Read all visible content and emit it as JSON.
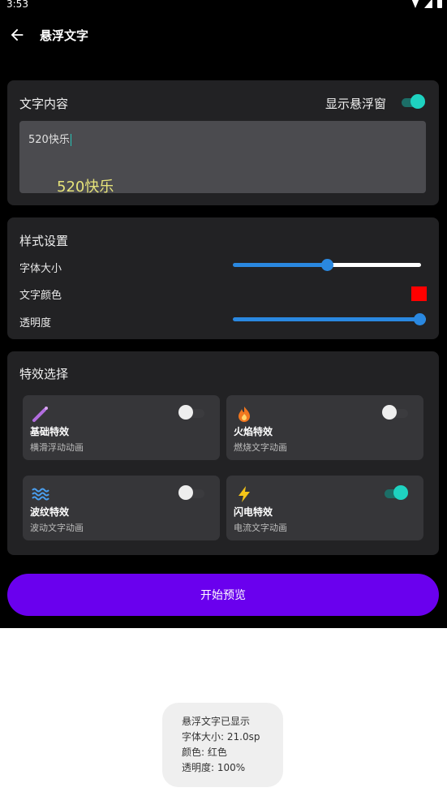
{
  "status_bar": {
    "time": "3:53"
  },
  "topbar": {
    "title": "悬浮文字",
    "back_icon": "arrow-left-icon"
  },
  "content_card": {
    "heading": "文字内容",
    "toggle_label": "显示悬浮窗",
    "toggle_on": true,
    "input_value": "520快乐",
    "preview_text": "520快乐",
    "preview_color": "#e6e37a"
  },
  "style_card": {
    "heading": "样式设置",
    "font_size_label": "字体大小",
    "font_size_fraction": 0.5,
    "text_color_label": "文字颜色",
    "text_color": "#ff0000",
    "opacity_label": "透明度",
    "opacity_fraction": 1.0
  },
  "effects_card": {
    "heading": "特效选择",
    "items": [
      {
        "name": "基础特效",
        "desc": "横滑浮动动画",
        "icon": "wand-icon",
        "enabled": false
      },
      {
        "name": "火焰特效",
        "desc": "燃烧文字动画",
        "icon": "fire-icon",
        "enabled": false
      },
      {
        "name": "波纹特效",
        "desc": "波动文字动画",
        "icon": "wave-icon",
        "enabled": false
      },
      {
        "name": "闪电特效",
        "desc": "电流文字动画",
        "icon": "lightning-icon",
        "enabled": true
      }
    ]
  },
  "start_button": {
    "label": "开始预览",
    "color": "#6a00ee"
  },
  "toast": {
    "line1": "悬浮文字已显示",
    "line2": "字体大小: 21.0sp",
    "line3": "颜色: 红色",
    "line4": "透明度: 100%"
  },
  "colors": {
    "accent_teal": "#1ed2c0",
    "slider_blue": "#2a88e0"
  }
}
